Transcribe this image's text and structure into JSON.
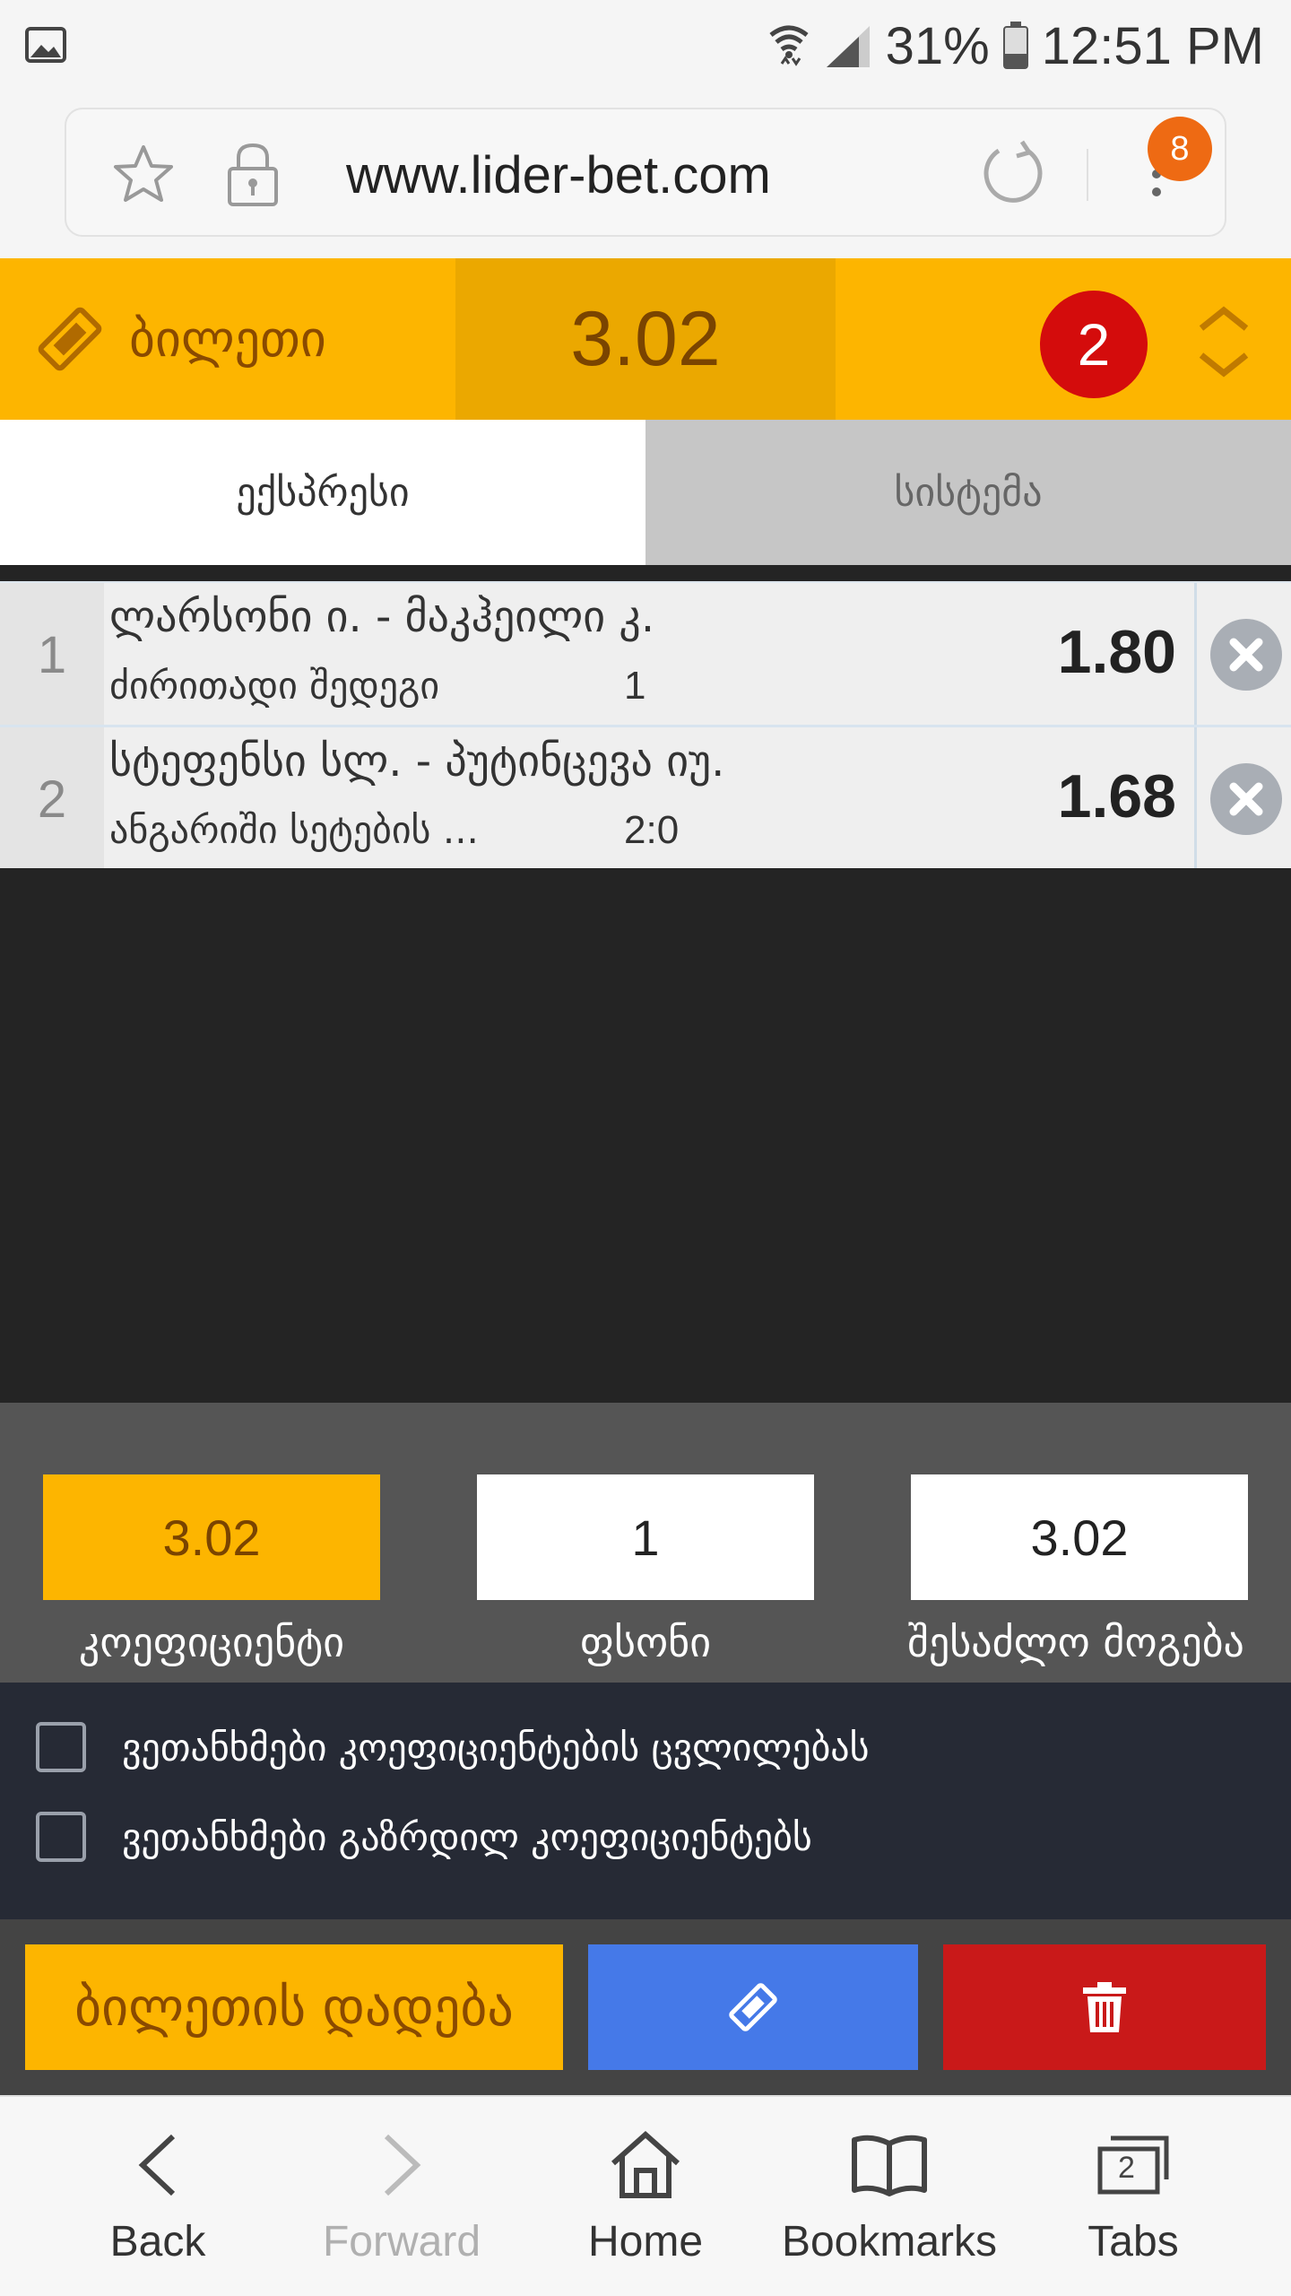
{
  "status_bar": {
    "battery": "31%",
    "time": "12:51 PM"
  },
  "browser": {
    "url": "www.lider-bet.com",
    "menu_badge": "8"
  },
  "ticket": {
    "title": "ბილეთი",
    "total_odds": "3.02",
    "selection_count": "2",
    "accent_color": "#fdb500"
  },
  "tabs": [
    {
      "label": "ექსპრესი",
      "active": true
    },
    {
      "label": "სისტემა",
      "active": false
    }
  ],
  "bets": [
    {
      "index": "1",
      "match": "ლარსონი ი. - მაკჰეილი კ.",
      "market": "ძირითადი შედეგი",
      "selection": "1",
      "odds": "1.80"
    },
    {
      "index": "2",
      "match": "სტეფენსი სლ. - პუტინცევა იუ.",
      "market": "ანგარიში სეტების ...",
      "selection": "2:0",
      "odds": "1.68"
    }
  ],
  "stake_panel": {
    "coefficient_value": "3.02",
    "coefficient_label": "კოეფიციენტი",
    "stake_value": "1",
    "stake_label": "ფსონი",
    "win_value": "3.02",
    "win_label": "შესაძლო მოგება"
  },
  "agreements": [
    {
      "label": "ვეთანხმები კოეფიციენტების ცვლილებას",
      "checked": false
    },
    {
      "label": "ვეთანხმები გაზრდილ კოეფიციენტებს",
      "checked": false
    }
  ],
  "actions": {
    "place_label": "ბილეთის დადება",
    "save_icon": "ticket-icon",
    "delete_icon": "trash-icon"
  },
  "browser_nav": {
    "back": "Back",
    "forward": "Forward",
    "home": "Home",
    "bookmarks": "Bookmarks",
    "tabs": "Tabs",
    "tabs_count": "2"
  }
}
